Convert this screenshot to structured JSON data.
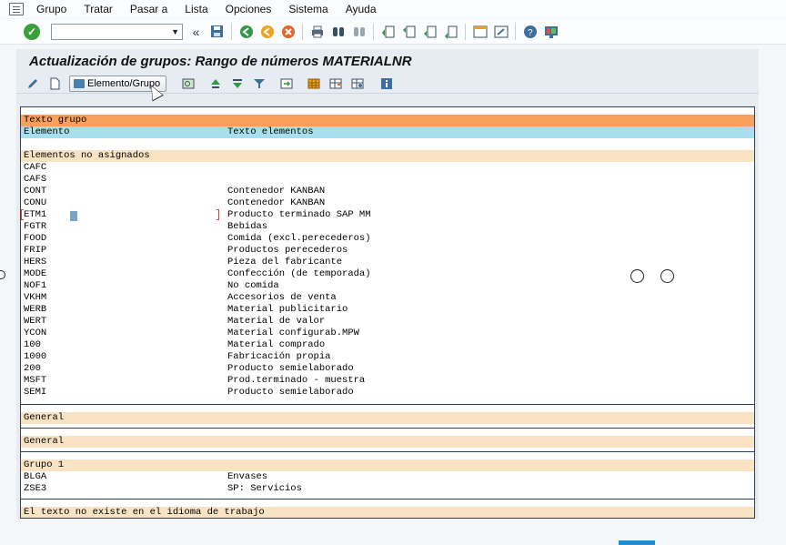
{
  "menu": [
    "Grupo",
    "Tratar",
    "Pasar a",
    "Lista",
    "Opciones",
    "Sistema",
    "Ayuda"
  ],
  "title": "Actualización de grupos: Rango de números MATERIALNR",
  "app_toolbar": {
    "element_group_button": "Elemento/Grupo"
  },
  "colors": {
    "header_orange": "#f9a05c",
    "header_blue": "#a8dff0",
    "section_peach": "#fae3c3"
  },
  "list": {
    "header_group": "Texto grupo",
    "col_element": "Elemento",
    "col_text": "Texto elementos",
    "unassigned_title": "Elementos no asignados",
    "unassigned": [
      {
        "code": "CAFC",
        "text": ""
      },
      {
        "code": "CAFS",
        "text": ""
      },
      {
        "code": "CONT",
        "text": "Contenedor KANBAN"
      },
      {
        "code": "CONU",
        "text": "Contenedor KANBAN"
      },
      {
        "code": "ETM1",
        "text": "Producto terminado SAP MM"
      },
      {
        "code": "FGTR",
        "text": "Bebidas"
      },
      {
        "code": "FOOD",
        "text": "Comida (excl.perecederos)"
      },
      {
        "code": "FRIP",
        "text": "Productos perecederos"
      },
      {
        "code": "HERS",
        "text": "Pieza del fabricante"
      },
      {
        "code": "MODE",
        "text": "Confección (de temporada)"
      },
      {
        "code": "NOF1",
        "text": "No comida"
      },
      {
        "code": "VKHM",
        "text": "Accesorios de venta"
      },
      {
        "code": "WERB",
        "text": "Material publicitario"
      },
      {
        "code": "WERT",
        "text": "Material de valor"
      },
      {
        "code": "YCON",
        "text": "Material configurab.MPW"
      },
      {
        "code": "100",
        "text": "Material comprado"
      },
      {
        "code": "1000",
        "text": "Fabricación propia"
      },
      {
        "code": "200",
        "text": "Producto semielaborado"
      },
      {
        "code": "MSFT",
        "text": "Prod.terminado - muestra"
      },
      {
        "code": "SEMI",
        "text": "Producto semielaborado"
      }
    ],
    "general_1": "General",
    "general_2": "General",
    "group1_title": "Grupo 1",
    "group1": [
      {
        "code": "BLGA",
        "text": "Envases"
      },
      {
        "code": "ZSE3",
        "text": "SP: Servicios"
      }
    ],
    "no_text_title": "El texto no existe en el idioma de trabajo"
  }
}
